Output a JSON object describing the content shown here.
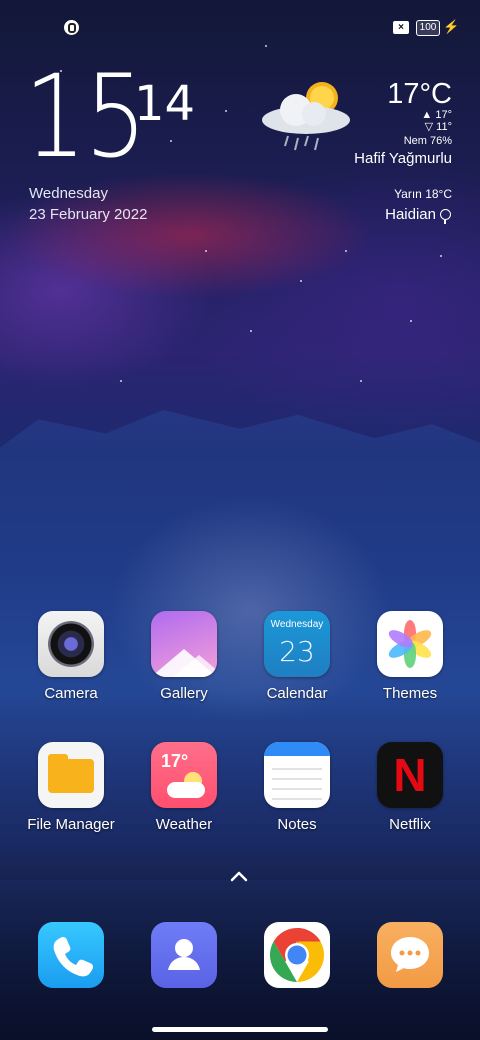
{
  "status_bar": {
    "left_icon": "notification-app-icon",
    "sim_icon": "no-sim-icon",
    "battery_level": "100",
    "charging_icon": "charging-bolt-icon"
  },
  "clock_widget": {
    "hours": "15",
    "minutes": "14",
    "day": "Wednesday",
    "date": "23 February 2022"
  },
  "weather_widget": {
    "icon": "cloud-sun-rain-icon",
    "temperature": "17°C",
    "high": "▲ 17°",
    "low": "▽ 11°",
    "humidity": "Nem 76%",
    "condition": "Hafif Yağmurlu",
    "tomorrow": "Yarın 18°C",
    "city": "Haidian"
  },
  "apps": [
    {
      "label": "Camera",
      "icon": "camera-icon"
    },
    {
      "label": "Gallery",
      "icon": "gallery-icon"
    },
    {
      "label": "Calendar",
      "icon": "calendar-icon",
      "icon_day": "Wednesday",
      "icon_date": "23"
    },
    {
      "label": "Themes",
      "icon": "themes-icon"
    },
    {
      "label": "File Manager",
      "icon": "file-manager-icon"
    },
    {
      "label": "Weather",
      "icon": "weather-icon",
      "icon_temp": "17°"
    },
    {
      "label": "Notes",
      "icon": "notes-icon"
    },
    {
      "label": "Netflix",
      "icon": "netflix-icon",
      "icon_letter": "N"
    }
  ],
  "dock": [
    {
      "icon": "phone-icon"
    },
    {
      "icon": "contacts-icon"
    },
    {
      "icon": "chrome-icon"
    },
    {
      "icon": "messages-icon"
    }
  ],
  "colors": {
    "accent_blue": "#1a9cf0",
    "netflix_red": "#e50914",
    "contacts_purple": "#5a63e6",
    "messages_orange": "#f29a45"
  }
}
